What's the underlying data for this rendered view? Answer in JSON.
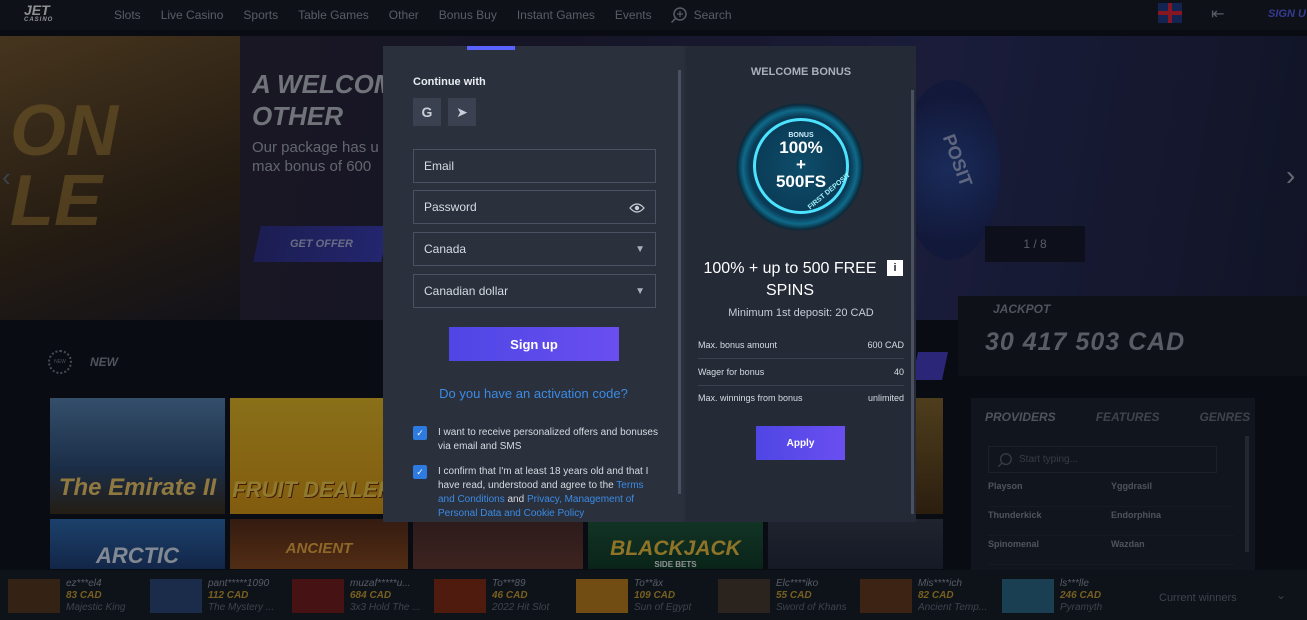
{
  "nav": {
    "logo_main": "JET",
    "logo_sub": "CASINO",
    "items": [
      "Slots",
      "Live Casino",
      "Sports",
      "Table Games",
      "Other",
      "Bonus Buy",
      "Instant Games",
      "Events"
    ],
    "search_label": "Search",
    "signup_label": "SIGN U"
  },
  "hero": {
    "left_art_text": "ON\nLE",
    "title_line1": "A WELCOM",
    "title_line2": "OTHER",
    "subtitle_line1": "Our package has u",
    "subtitle_line2": "max bonus of 600",
    "cta_label": "GET OFFER",
    "slide_counter": "1 / 8",
    "deco_text": "POSIT"
  },
  "jackpot": {
    "label": "JACKPOT",
    "value": "30 417 503 CAD"
  },
  "section_new": {
    "badge": "NEW",
    "label": "NEW"
  },
  "games": {
    "emirate": "The Emirate II",
    "fruit_dealers": "FRUIT DEALER$",
    "arctic": "ARCTIC",
    "ancient": "ANCIENT",
    "blackjack": "BLACKJACK",
    "blackjack_sub": "SIDE BETS"
  },
  "providers": {
    "tabs": [
      "PROVIDERS",
      "FEATURES",
      "GENRES"
    ],
    "search_placeholder": "Start typing...",
    "items": [
      "Playson",
      "Yggdrasil",
      "Thunderkick",
      "Endorphina",
      "Spinomenal",
      "Wazdan"
    ]
  },
  "winners": {
    "list": [
      {
        "name": "ez***el4",
        "amount": "83 CAD",
        "game": "Majestic King",
        "color": "#5a3a1a"
      },
      {
        "name": "pant*****1090",
        "amount": "112 CAD",
        "game": "The Mystery ...",
        "color": "#2a4a7a"
      },
      {
        "name": "muzaf*****u...",
        "amount": "684 CAD",
        "game": "3x3 Hold The ...",
        "color": "#7a1a1a"
      },
      {
        "name": "To***89",
        "amount": "46 CAD",
        "game": "2022 Hit Slot",
        "color": "#8a2a10"
      },
      {
        "name": "To**äx",
        "amount": "109 CAD",
        "game": "Sun of Egypt",
        "color": "#c8861a"
      },
      {
        "name": "Elc****iko",
        "amount": "55 CAD",
        "game": "Sword of Khans",
        "color": "#4a3a2a"
      },
      {
        "name": "Mis****ich",
        "amount": "82 CAD",
        "game": "Ancient Temp...",
        "color": "#6a3a1a"
      },
      {
        "name": "ls***lle",
        "amount": "246 CAD",
        "game": "Pyramyth",
        "color": "#2a6a8a"
      }
    ],
    "current_label": "Current winners"
  },
  "modal": {
    "continue_with": "Continue with",
    "social": [
      "G",
      "➤"
    ],
    "email_placeholder": "Email",
    "password_placeholder": "Password",
    "country": "Canada",
    "currency": "Canadian dollar",
    "signup_button": "Sign up",
    "activation_link": "Do you have an activation code?",
    "consent_offers": "I want to receive personalized offers and bonuses via email and SMS",
    "consent_age_prefix": "I confirm that I'm at least 18 years old and that I have read, understood and agree to the ",
    "consent_terms_link": "Terms and Conditions",
    "consent_and": " and ",
    "consent_privacy_link": "Privacy, Management of Personal Data and Cookie Policy",
    "bonus": {
      "title": "WELCOME BONUS",
      "badge_small": "BONUS",
      "badge_line1": "100%",
      "badge_plus": "+",
      "badge_line2": "500FS",
      "badge_ribbon": "FIRST DEPOSIT",
      "offer": "100% + up to 500 FREE SPINS",
      "info": "i",
      "min_deposit": "Minimum 1st deposit: 20 CAD",
      "rows": [
        {
          "label": "Max. bonus amount",
          "value": "600 CAD"
        },
        {
          "label": "Wager for bonus",
          "value": "40"
        },
        {
          "label": "Max. winnings from bonus",
          "value": "unlimited"
        }
      ],
      "apply_button": "Apply"
    }
  }
}
